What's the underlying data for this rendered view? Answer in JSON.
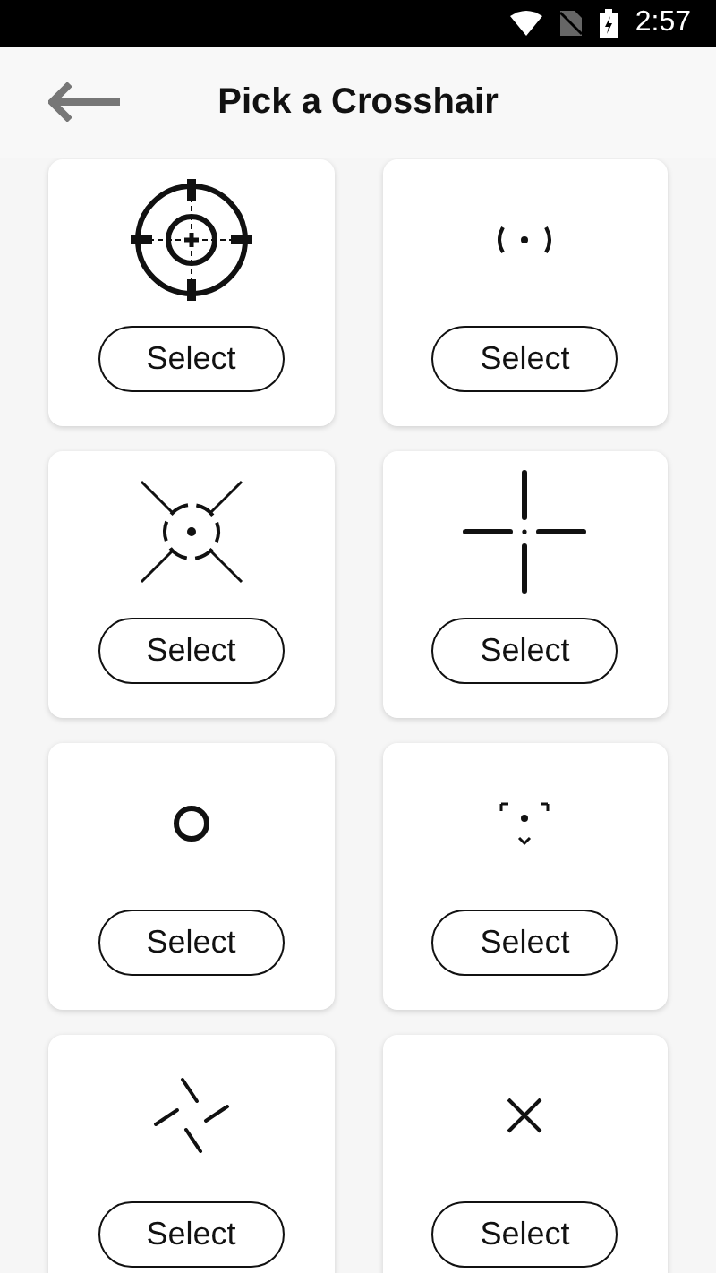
{
  "status_bar": {
    "time": "2:57"
  },
  "header": {
    "title": "Pick a Crosshair"
  },
  "crosshairs": [
    {
      "kind": "scope",
      "button": "Select"
    },
    {
      "kind": "dot-brackets",
      "button": "Select"
    },
    {
      "kind": "x-dot",
      "button": "Select"
    },
    {
      "kind": "gap-cross",
      "button": "Select"
    },
    {
      "kind": "ring",
      "button": "Select"
    },
    {
      "kind": "triangle-dot",
      "button": "Select"
    },
    {
      "kind": "pinwheel",
      "button": "Select"
    },
    {
      "kind": "x",
      "button": "Select"
    }
  ]
}
